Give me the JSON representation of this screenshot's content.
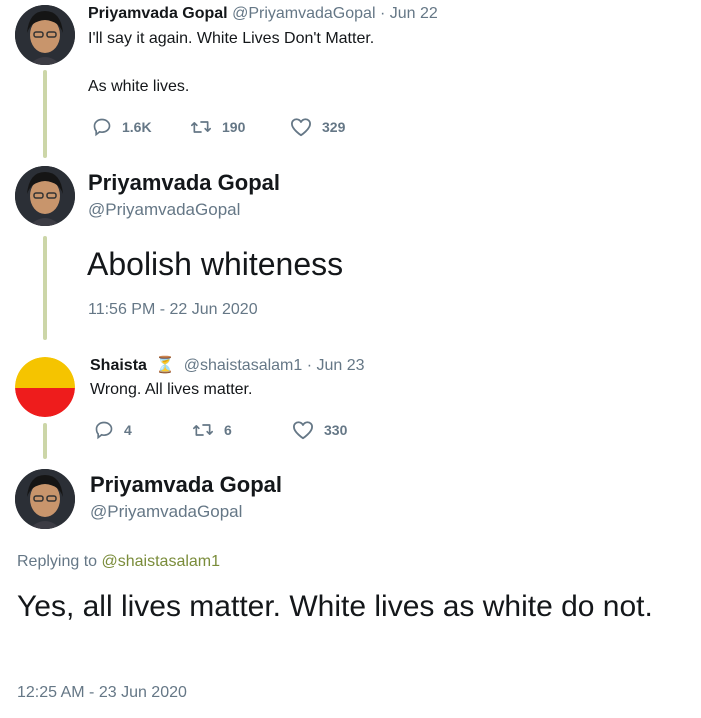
{
  "tweets": [
    {
      "name": "Priyamvada Gopal",
      "handle": "@PriyamvadaGopal",
      "date": "· Jun 22",
      "lines": [
        "I'll say it again. White Lives Don't Matter.",
        "As white lives."
      ],
      "replies": "1.6K",
      "retweets": "190",
      "likes": "329"
    },
    {
      "name": "Priyamvada Gopal",
      "handle": "@PriyamvadaGopal",
      "text": "Abolish whiteness",
      "timestamp": "11:56 PM - 22 Jun 2020"
    },
    {
      "name": "Shaista",
      "emoji": "⏳",
      "handle": "@shaistasalam1",
      "date": "· Jun 23",
      "text": "Wrong. All lives matter.",
      "replies": "4",
      "retweets": "6",
      "likes": "330"
    },
    {
      "name": "Priyamvada Gopal",
      "handle": "@PriyamvadaGopal",
      "replying_prefix": "Replying to",
      "replying_to": "@shaistasalam1",
      "text": "Yes, all lives matter. White lives as white do not.",
      "timestamp": "12:25 AM - 23 Jun 2020"
    }
  ],
  "colors": {
    "thread_line": "#ccd6a8",
    "muted": "#657786",
    "link": "#7a8c3a",
    "avatar_top": "#f5c400",
    "avatar_bottom": "#ee1c1c"
  },
  "icons": {
    "reply": "reply-icon",
    "retweet": "retweet-icon",
    "like": "heart-icon"
  }
}
